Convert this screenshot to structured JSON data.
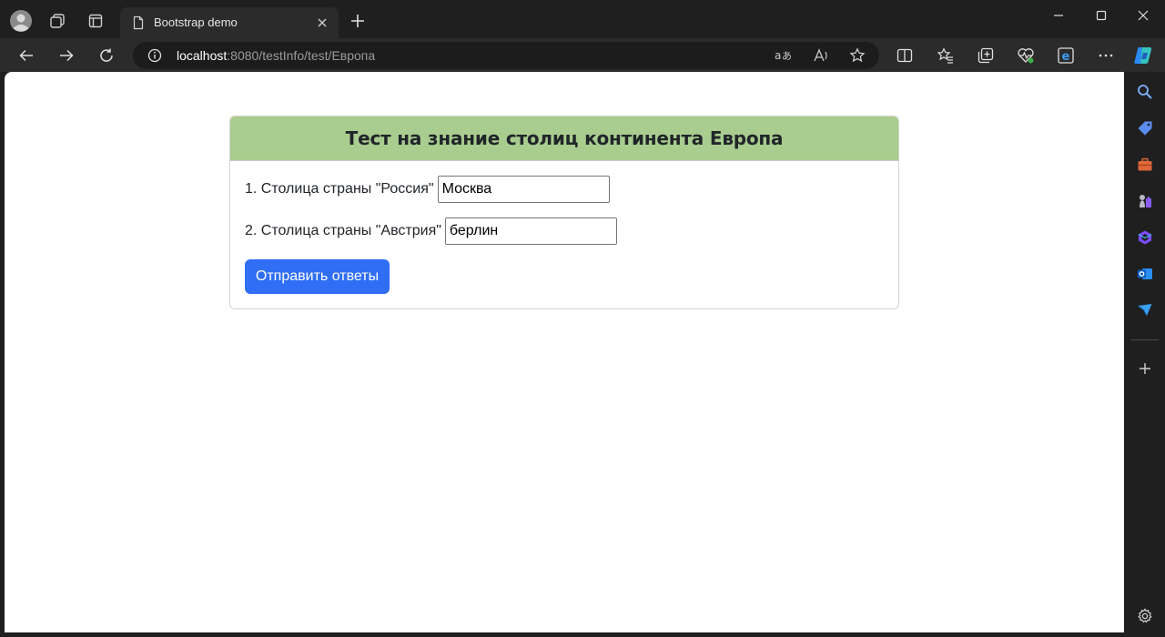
{
  "browser": {
    "tab_title": "Bootstrap demo",
    "url_host": "localhost",
    "url_path": ":8080/testInfo/test/Европа"
  },
  "quiz": {
    "title": "Тест на знание столиц континента Европа",
    "questions": [
      {
        "label": "1. Столица страны \"Россия\"",
        "answer": "Москва"
      },
      {
        "label": "2. Столица страны \"Австрия\"",
        "answer": "берлин"
      }
    ],
    "submit_label": "Отправить ответы"
  },
  "colors": {
    "header_bg": "#a9cd8f",
    "button_bg": "#2f6ef5"
  }
}
